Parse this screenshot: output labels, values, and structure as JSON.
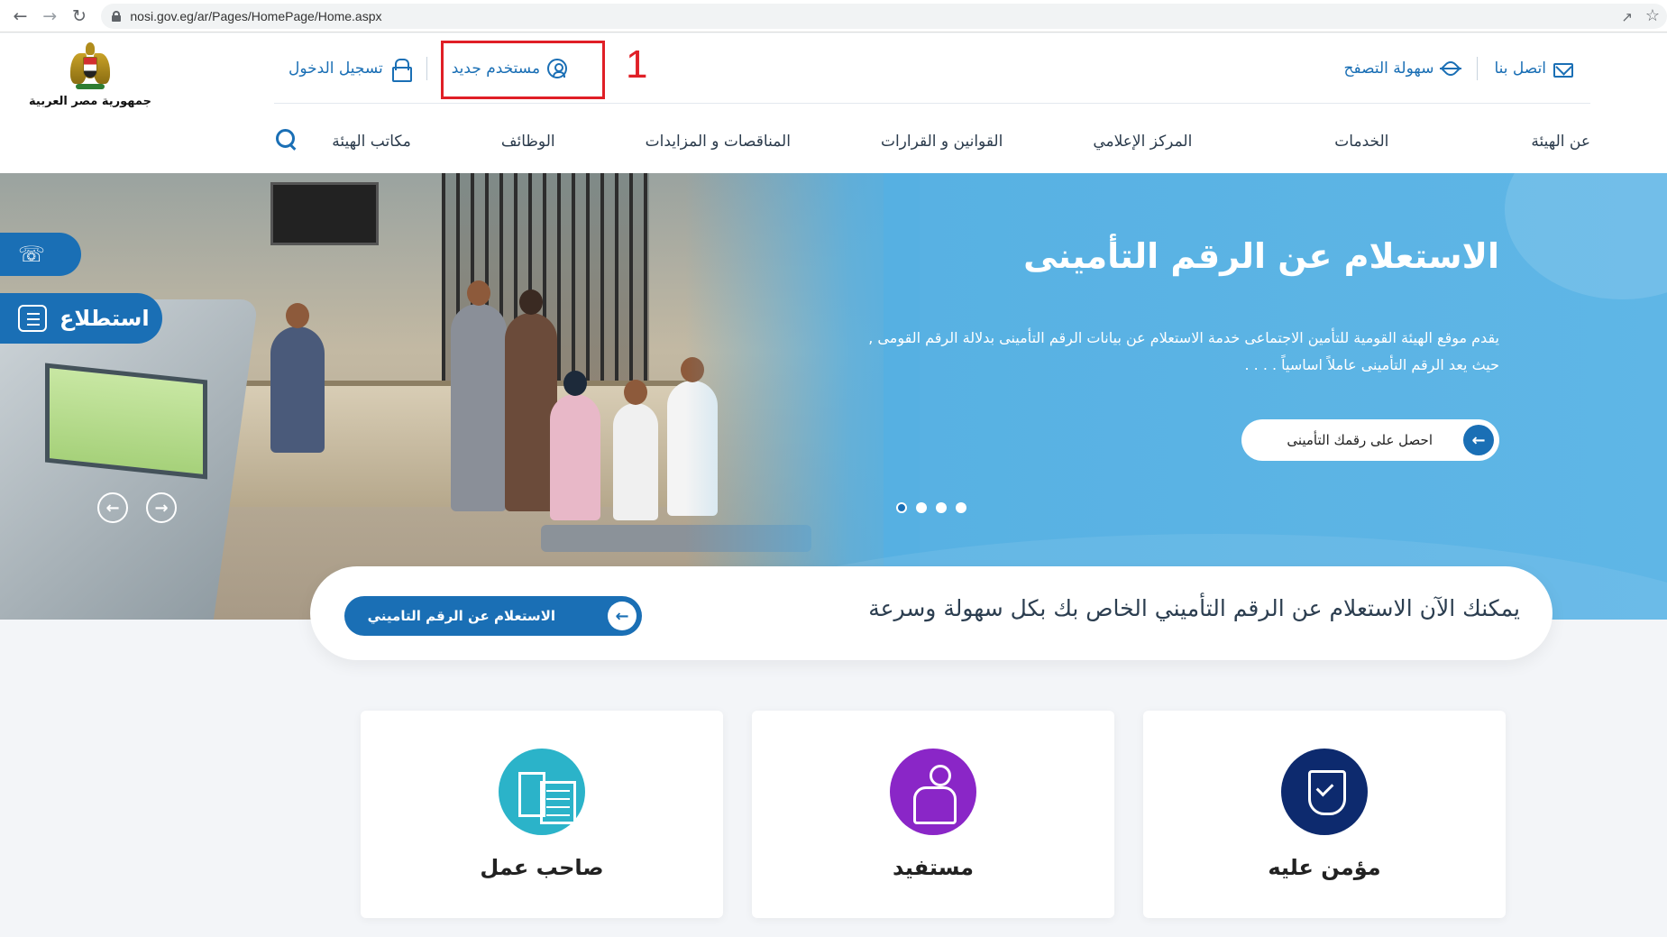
{
  "browser": {
    "url": "nosi.gov.eg/ar/Pages/HomePage/Home.aspx"
  },
  "header": {
    "logo_text": "جمهورية مصر العربية",
    "contact_label": "اتصل بنا",
    "accessibility_label": "سهولة التصفح",
    "new_user_label": "مستخدم جديد",
    "login_label": "تسجيل الدخول",
    "annotation_number": "1"
  },
  "nav": {
    "items": [
      "عن الهيئة",
      "الخدمات",
      "المركز الإعلامي",
      "القوانين و القرارات",
      "المناقصات و المزايدات",
      "الوظائف",
      "مكاتب الهيئة"
    ]
  },
  "hero": {
    "title": "الاستعلام عن الرقم التأمينى",
    "description": "يقدم موقع الهيئة القومية للتأمين الاجتماعى خدمة الاستعلام عن بيانات الرقم التأمينى بدلالة الرقم القومى , حيث يعد الرقم التأمينى عاملاً اساسياً . . . .",
    "cta_label": "احصل على رقمك التأمينى",
    "slide_count": 4,
    "active_slide": 1
  },
  "side_tabs": {
    "survey_label": "استطلاع"
  },
  "query_strip": {
    "text": "يمكنك الآن الاستعلام عن الرقم التأميني الخاص بك بكل سهولة وسرعة",
    "button_label": "الاستعلام عن الرقم التاميني"
  },
  "cards": [
    {
      "title": "مؤمن عليه",
      "icon": "shield-check-icon",
      "color": "#0d2a6e"
    },
    {
      "title": "مستفيد",
      "icon": "family-icon",
      "color": "#8a26c7"
    },
    {
      "title": "صاحب عمل",
      "icon": "building-icon",
      "color": "#2bb3c9"
    }
  ],
  "colors": {
    "primary": "#1a6fb5",
    "hero_bg": "#56b0e2",
    "highlight": "#e01f26"
  }
}
